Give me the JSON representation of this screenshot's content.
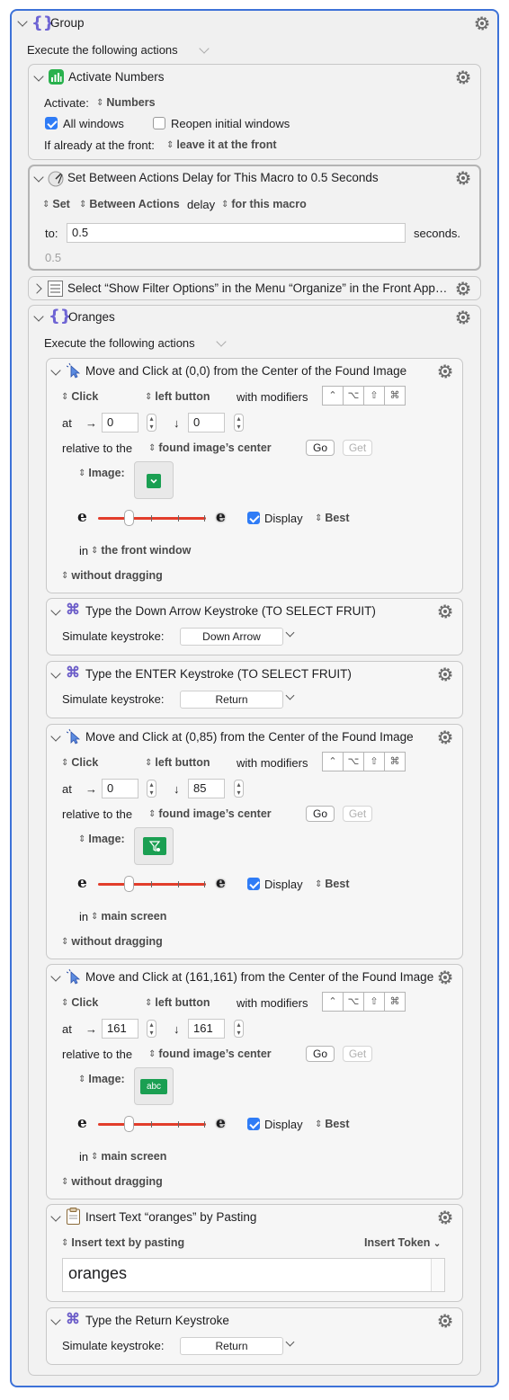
{
  "group": {
    "title": "Group",
    "execute": "Execute the following actions"
  },
  "activate": {
    "title": "Activate Numbers",
    "activate_label": "Activate:",
    "app": "Numbers",
    "all_windows": "All windows",
    "reopen": "Reopen initial windows",
    "front_label": "If already at the front:",
    "front_value": "leave it at the front"
  },
  "delay": {
    "title": "Set Between Actions Delay for This Macro to 0.5 Seconds",
    "set": "Set",
    "between": "Between Actions",
    "delay_word": "delay",
    "scope": "for this macro",
    "to_label": "to:",
    "value": "0.5",
    "seconds": "seconds.",
    "hint": "0.5"
  },
  "select_menu": {
    "title": "Select “Show Filter Options” in the Menu “Organize” in the Front App…"
  },
  "oranges": {
    "title": "Oranges",
    "execute": "Execute the following actions"
  },
  "labels": {
    "click": "Click",
    "left_button": "left button",
    "with_modifiers": "with modifiers",
    "at": "at",
    "relative": "relative to the",
    "found_center": "found image’s center",
    "go": "Go",
    "get": "Get",
    "image": "Image:",
    "display": "Display",
    "best": "Best",
    "in": "in",
    "without_dragging": "without dragging",
    "simulate": "Simulate keystroke:",
    "arrow_right": "→",
    "arrow_down": "↓",
    "mods": [
      "⌃",
      "⌥",
      "⇧",
      "⌘"
    ]
  },
  "click1": {
    "title": "Move and Click at (0,0) from the Center of the Found Image",
    "x": "0",
    "y": "0",
    "screen": "the front window"
  },
  "type_down": {
    "title": "Type the Down Arrow Keystroke (TO SELECT FRUIT)",
    "key": "Down Arrow"
  },
  "type_enter": {
    "title": "Type the ENTER Keystroke (TO SELECT FRUIT)",
    "key": "Return"
  },
  "click2": {
    "title": "Move and Click at (0,85) from the Center of the Found Image",
    "x": "0",
    "y": "85",
    "screen": "main screen"
  },
  "click3": {
    "title": "Move and Click at (161,161) from the Center of the Found Image",
    "x": "161",
    "y": "161",
    "screen": "main screen",
    "thumb_text": "abc"
  },
  "insert": {
    "title": "Insert Text “oranges” by Pasting",
    "mode": "Insert text by pasting",
    "token": "Insert Token",
    "text": "oranges"
  },
  "type_return": {
    "title": "Type the Return Keystroke",
    "key": "Return"
  },
  "colors": {
    "accent": "#3d72d8",
    "green": "#1a9f52",
    "slider": "#e23d2b",
    "checkbox": "#2f7cf6"
  }
}
